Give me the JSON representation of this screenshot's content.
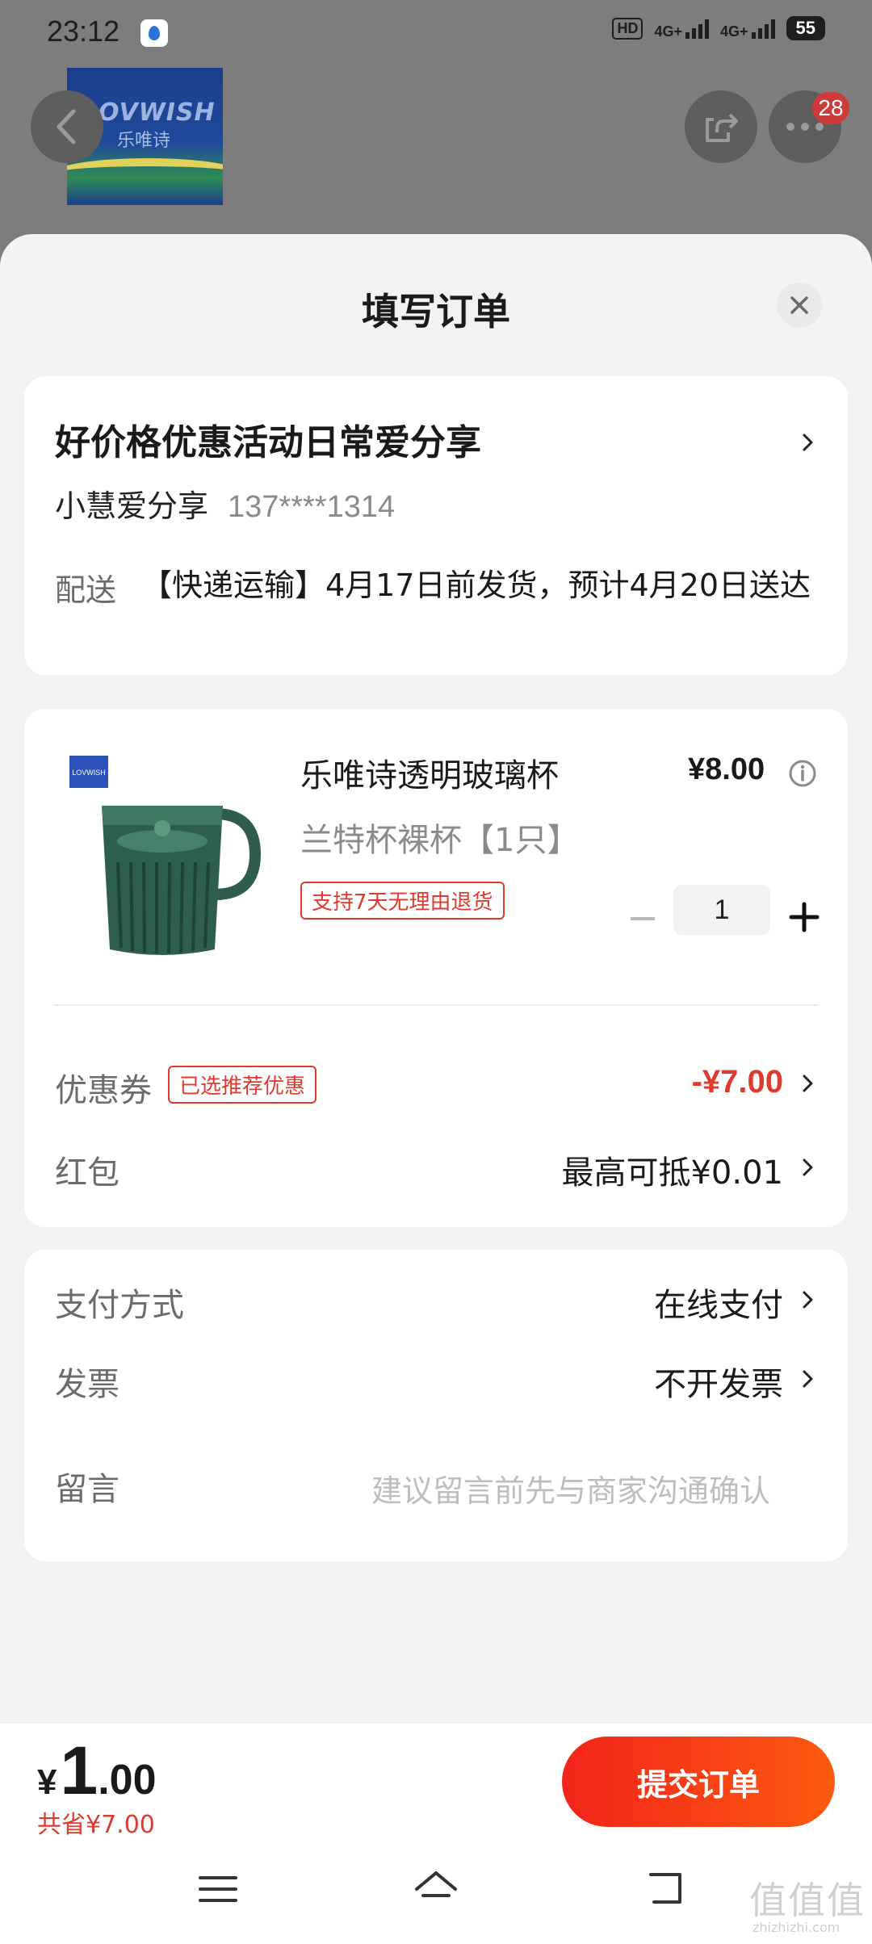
{
  "status_bar": {
    "time": "23:12",
    "hd": "HD",
    "sim1": "4G+",
    "sim2": "4G+",
    "battery": "55"
  },
  "background": {
    "brand_logo_text": "LOVWISH",
    "brand_logo_cn": "乐唯诗",
    "more_badge": "28"
  },
  "sheet": {
    "title": "填写订单"
  },
  "address": {
    "name": "好价格优惠活动日常爱分享",
    "receiver": "小慧爱分享",
    "phone": "137****1314",
    "shipping_label": "配送",
    "shipping_text": "【快递运输】4月17日前发货，预计4月20日送达"
  },
  "product": {
    "name": "乐唯诗透明玻璃杯",
    "spec": "兰特杯裸杯【1只】",
    "return_tag": "支持7天无理由退货",
    "price": "¥8.00",
    "quantity": "1",
    "image_brand": "LOVWISH"
  },
  "discounts": {
    "coupon_label": "优惠券",
    "coupon_tag": "已选推荐优惠",
    "coupon_value": "-¥7.00",
    "redpacket_label": "红包",
    "redpacket_value": "最高可抵¥0.01"
  },
  "payment": {
    "method_label": "支付方式",
    "method_value": "在线支付",
    "invoice_label": "发票",
    "invoice_value": "不开发票",
    "remark_label": "留言",
    "remark_placeholder": "建议留言前先与商家沟通确认"
  },
  "footer": {
    "currency": "¥",
    "total_int": "1",
    "total_dec": ".00",
    "saved": "共省¥7.00",
    "submit_label": "提交订单"
  },
  "watermark": {
    "text": "值值值",
    "sub": "zhizhizhi.com"
  },
  "colors": {
    "accent_red": "#e03a2f",
    "submit_gradient_start": "#f3241b",
    "submit_gradient_end": "#fb5a10"
  }
}
